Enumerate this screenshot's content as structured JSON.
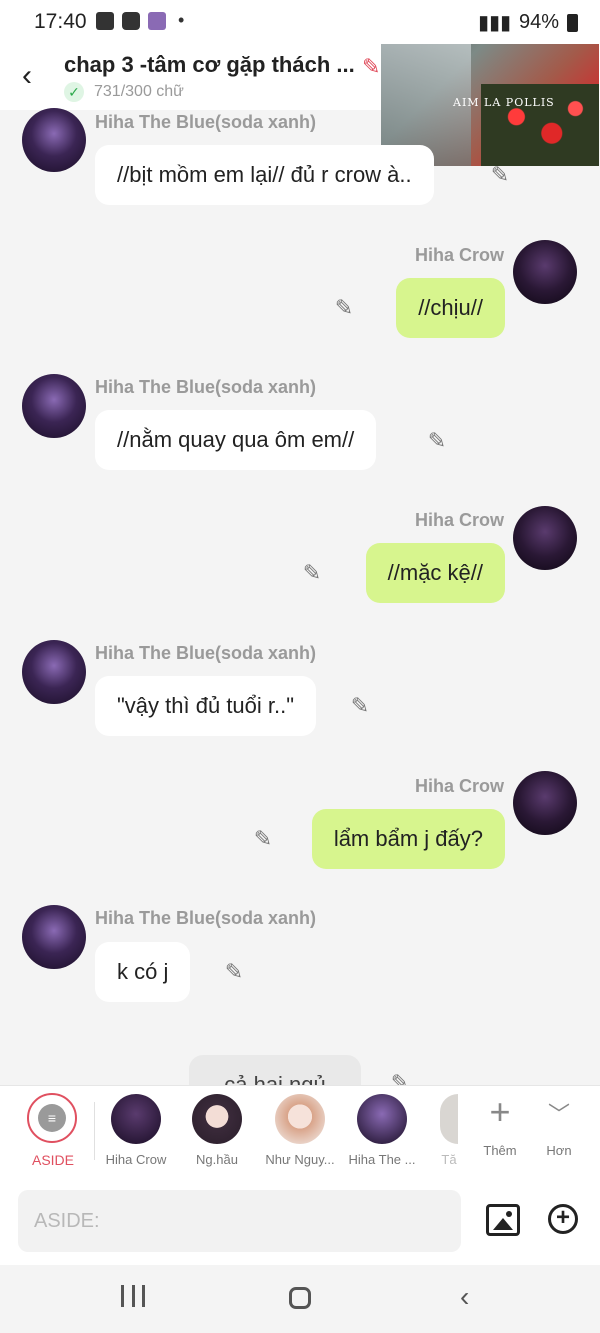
{
  "status_bar": {
    "time": "17:40",
    "dot": "•",
    "right_text": "94%"
  },
  "header": {
    "title": "chap 3 -tâm cơ gặp thách ...",
    "word_count": "731/300 chữ",
    "thumbnail_caption": "AIM LA POLLIS"
  },
  "messages": [
    {
      "side": "left",
      "name": "Hiha The Blue(soda xanh)",
      "text": "//bịt mồm em lại// đủ r crow à.."
    },
    {
      "side": "right",
      "name": "Hiha Crow",
      "text": "//chịu//"
    },
    {
      "side": "left",
      "name": "Hiha The Blue(soda xanh)",
      "text": "//nằm quay qua ôm em//"
    },
    {
      "side": "right",
      "name": "Hiha Crow",
      "text": "//mặc kệ//"
    },
    {
      "side": "left",
      "name": "Hiha The Blue(soda xanh)",
      "text": "\"vậy thì đủ tuổi r..\""
    },
    {
      "side": "right",
      "name": "Hiha Crow",
      "text": "lẩm bẩm j đấy?"
    },
    {
      "side": "left",
      "name": "Hiha The Blue(soda xanh)",
      "text": "k có j"
    },
    {
      "side": "center",
      "text": "cả hai ngủ"
    }
  ],
  "characters": {
    "aside": "ASIDE",
    "items": [
      {
        "label": "Hiha Crow"
      },
      {
        "label": "Ng.hầu"
      },
      {
        "label": "Như Nguy..."
      },
      {
        "label": "Hiha The ..."
      },
      {
        "label": "Tă"
      }
    ],
    "more_label": "Thêm",
    "expand_label": "Hơn"
  },
  "input": {
    "placeholder": "ASIDE:",
    "value": ""
  }
}
